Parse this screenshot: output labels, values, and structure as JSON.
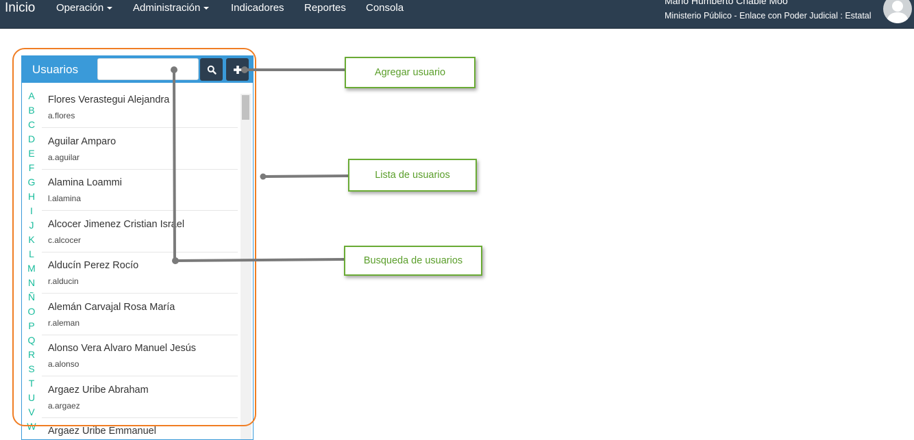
{
  "navbar": {
    "brand": "Inicio",
    "items": [
      {
        "label": "Operación",
        "has_caret": true
      },
      {
        "label": "Administración",
        "has_caret": true
      },
      {
        "label": "Indicadores",
        "has_caret": false
      },
      {
        "label": "Reportes",
        "has_caret": false
      },
      {
        "label": "Consola",
        "has_caret": false
      }
    ],
    "user_name": "Mario Humberto Chable Moo",
    "user_role": "Ministerio Público - Enlace con Poder Judicial : Estatal",
    "avatar_icon": "user-silhouette-icon"
  },
  "panel": {
    "title": "Usuarios",
    "search_value": "",
    "search_icon": "search-icon",
    "add_icon": "plus-icon",
    "alphabet": [
      "A",
      "B",
      "C",
      "D",
      "E",
      "F",
      "G",
      "H",
      "I",
      "J",
      "K",
      "L",
      "M",
      "N",
      "Ñ",
      "O",
      "P",
      "Q",
      "R",
      "S",
      "T",
      "U",
      "V",
      "W"
    ],
    "users": [
      {
        "name": "Flores Verastegui Alejandra",
        "login": "a.flores"
      },
      {
        "name": "Aguilar Amparo",
        "login": "a.aguilar"
      },
      {
        "name": "Alamina Loammi",
        "login": "l.alamina"
      },
      {
        "name": "Alcocer Jimenez Cristian Israel",
        "login": "c.alcocer"
      },
      {
        "name": "Alducín Perez Rocío",
        "login": "r.alducin"
      },
      {
        "name": "Alemán Carvajal Rosa María",
        "login": "r.aleman"
      },
      {
        "name": "Alonso Vera Alvaro Manuel Jesús",
        "login": "a.alonso"
      },
      {
        "name": "Argaez Uribe Abraham",
        "login": "a.argaez"
      },
      {
        "name": "Argaez Uribe Emmanuel",
        "login": ""
      }
    ]
  },
  "annotations": {
    "add_user": "Agregar usuario",
    "user_list": "Lista de usuarios",
    "user_search": "Busqueda de usuarios"
  },
  "colors": {
    "navbar_bg": "#2c3e50",
    "panel_header": "#3a9ad9",
    "alphabet_link": "#18bc9c",
    "highlight_border": "#f07d23",
    "callout_border": "#6aab35",
    "connector": "#7a7a7a"
  }
}
